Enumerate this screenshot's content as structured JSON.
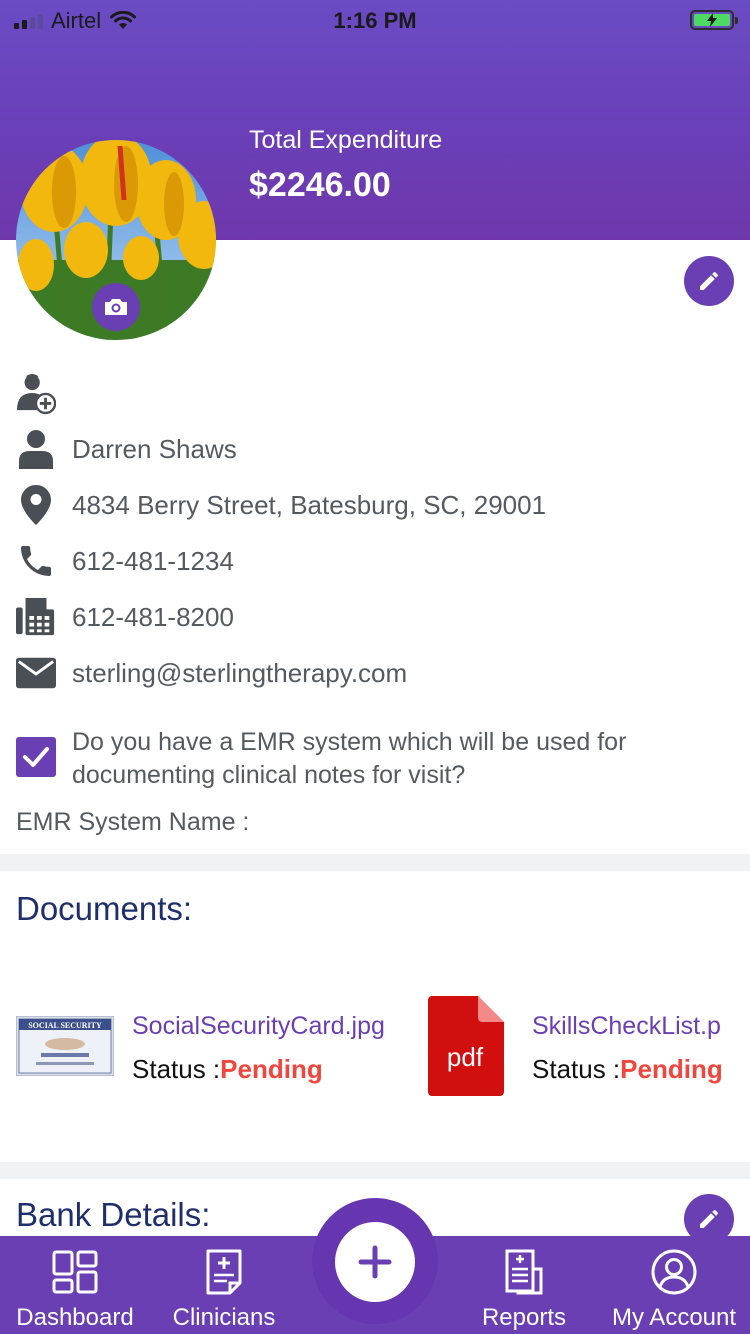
{
  "status_bar": {
    "carrier": "Airtel",
    "time": "1:16 PM",
    "signal_icon": "signal-bars-icon",
    "wifi_icon": "wifi-icon",
    "battery_icon": "battery-charging-icon"
  },
  "header": {
    "expenditure_label": "Total Expenditure",
    "expenditure_value": "$2246.00"
  },
  "profile": {
    "role_icon": "clinician-badge-icon",
    "name": "Darren Shaws",
    "address": "4834 Berry Street, Batesburg, SC, 29001",
    "phone": "612-481-1234",
    "fax": "612-481-8200",
    "email": "sterling@sterlingtherapy.com",
    "emr_question": "Do you have a EMR system which will be used for documenting clinical notes for visit?",
    "emr_checked": true,
    "emr_system_label": "EMR System Name :"
  },
  "documents": {
    "title": "Documents:",
    "items": [
      {
        "name": "SocialSecurityCard.jpg",
        "status_label": "Status :",
        "status": "Pending",
        "thumb": "social-security-card-thumbnail"
      },
      {
        "name": "SkillsCheckList.p",
        "status_label": "Status :",
        "status": "Pending",
        "thumb": "pdf-icon",
        "pdf_text": "pdf"
      }
    ]
  },
  "bank": {
    "title": "Bank Details:"
  },
  "bottom_nav": {
    "items": [
      {
        "label": "Dashboard",
        "icon": "dashboard-grid-icon"
      },
      {
        "label": "Clinicians",
        "icon": "clinician-clipboard-icon"
      },
      {
        "label": "Reports",
        "icon": "reports-document-icon"
      },
      {
        "label": "My Account",
        "icon": "user-circle-icon"
      }
    ],
    "fab_icon": "plus-icon"
  },
  "colors": {
    "primary": "#6a3fb4",
    "title_navy": "#1f2f6e",
    "pending_red": "#f2453d",
    "divider": "#f1f2f4"
  }
}
